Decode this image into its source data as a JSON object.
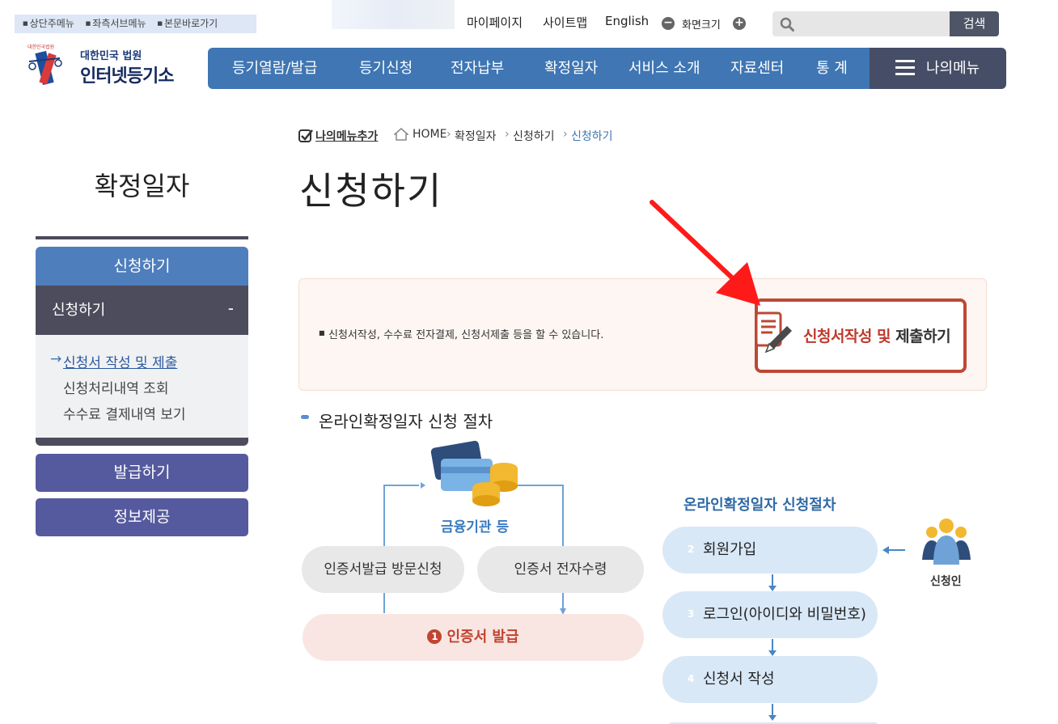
{
  "skip_links": [
    "상단주메뉴",
    "좌측서브메뉴",
    "본문바로가기"
  ],
  "utility": {
    "mypage": "마이페이지",
    "sitemap": "사이트맵",
    "english": "English",
    "zoom_label": "화면크기",
    "search_placeholder": "",
    "search_button": "검색"
  },
  "logo": {
    "emblem_text": "대한민국법원",
    "top": "대한민국 법원",
    "main": "인터넷등기소"
  },
  "gnb": {
    "items": [
      "등기열람/발급",
      "등기신청",
      "전자납부",
      "확정일자",
      "서비스 소개",
      "자료센터",
      "통 계"
    ],
    "my_menu": "나의메뉴"
  },
  "breadcrumb": {
    "add_menu": "나의메뉴추가",
    "home": "HOME",
    "level1": "확정일자",
    "level2": "신청하기",
    "current": "신청하기"
  },
  "side": {
    "title": "확정일자",
    "head": "신청하기",
    "sub_head": "신청하기",
    "sub_toggle": "-",
    "links": [
      "신청서 작성 및 제출",
      "신청처리내역 조회",
      "수수료 결제내역 보기"
    ],
    "active_index": 0,
    "buttons": [
      "발급하기",
      "정보제공"
    ]
  },
  "page": {
    "title": "신청하기",
    "info_text": "신청서작성, 수수료 전자결제, 신청서제출 등을 할 수 있습니다.",
    "apply_button_red": "신청서작성 및",
    "apply_button_dark": "제출하기",
    "section_title": "온라인확정일자 신청 절차"
  },
  "process": {
    "finance": "금융기관 등",
    "visit": "인증서발급 방문신청",
    "online_receive": "인증서 전자수령",
    "cert_issue_num": "1",
    "cert_issue": "인증서 발급",
    "steps_title": "온라인확정일자 신청절차",
    "steps": [
      {
        "num": "2",
        "label": "회원가입"
      },
      {
        "num": "3",
        "label": "로그인(아이디와 비밀번호)"
      },
      {
        "num": "4",
        "label": "신청서 작성"
      }
    ],
    "applicant": "신청인"
  },
  "colors": {
    "gnb": "#3f76b3",
    "my_menu": "#464d66",
    "side_head": "#4f7ebd",
    "side_sub": "#4d4c5d",
    "side_buttons": "#555a9e",
    "apply_border": "#bd4836",
    "annotation_arrow": "#ff1a1a"
  }
}
